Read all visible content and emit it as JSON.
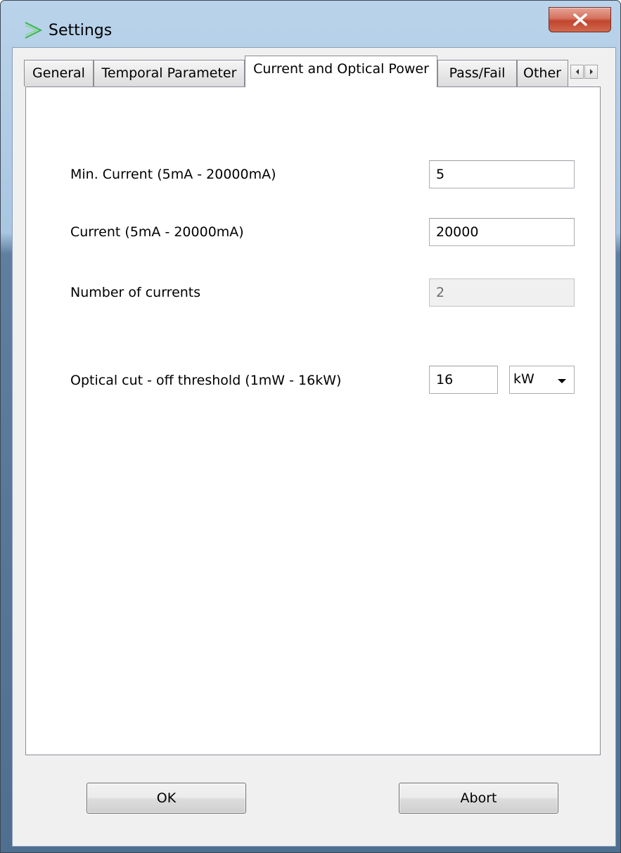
{
  "window": {
    "title": "Settings"
  },
  "tabs": [
    {
      "label": "General",
      "active": false
    },
    {
      "label": "Temporal Parameter",
      "active": false
    },
    {
      "label": "Current and Optical Power",
      "active": true
    },
    {
      "label": "Pass/Fail",
      "active": false
    },
    {
      "label": "Other",
      "active": false
    }
  ],
  "form": {
    "min_current": {
      "label": "Min. Current (5mA - 20000mA)",
      "value": "5"
    },
    "current": {
      "label": "Current (5mA - 20000mA)",
      "value": "20000"
    },
    "number_of_currents": {
      "label": "Number of currents",
      "value": "2",
      "disabled": true
    },
    "optical_cutoff": {
      "label": "Optical cut - off threshold  (1mW - 16kW)",
      "value": "16",
      "unit": "kW"
    }
  },
  "buttons": {
    "ok": "OK",
    "abort": "Abort"
  },
  "icons": {
    "app": "green-lines-icon",
    "close": "close-icon",
    "scroll_left": "arrow-left-icon",
    "scroll_right": "arrow-right-icon",
    "dropdown": "chevron-down-icon"
  },
  "colors": {
    "title_bar": "#b9d3ea",
    "close_button": "#c2452d",
    "dialog_background": "#f0f0f0"
  }
}
